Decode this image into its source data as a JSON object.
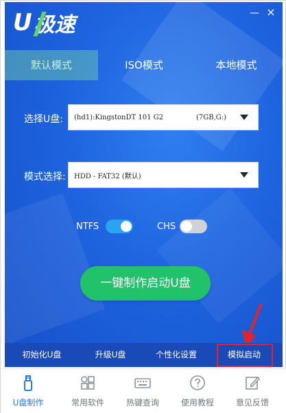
{
  "app": {
    "logo_u": "U",
    "logo_text": "极速",
    "minimize_glyph": "—",
    "close_glyph": "×"
  },
  "tabs": [
    {
      "label": "默认模式",
      "active": true
    },
    {
      "label": "ISO模式",
      "active": false
    },
    {
      "label": "本地模式",
      "active": false
    }
  ],
  "form": {
    "disk_label": "选择U盘:",
    "disk_name": "(hd1):KingstonDT 101 G2",
    "disk_size": "(7GB,G:)",
    "mode_label": "模式选择:",
    "mode_value": "HDD - FAT32 (默认)"
  },
  "toggles": {
    "ntfs_label": "NTFS",
    "ntfs_on": true,
    "chs_label": "CHS",
    "chs_on": false
  },
  "make_button": "一键制作启动U盘",
  "functions": [
    "初始化U盘",
    "升级U盘",
    "个性化设置",
    "模拟启动"
  ],
  "nav": [
    {
      "label": "U盘制作",
      "icon": "usb-icon",
      "active": true
    },
    {
      "label": "常用软件",
      "icon": "apps-grid-icon",
      "active": false
    },
    {
      "label": "热键查询",
      "icon": "keyboard-icon",
      "active": false
    },
    {
      "label": "使用教程",
      "icon": "help-icon",
      "active": false
    },
    {
      "label": "意见反馈",
      "icon": "edit-icon",
      "active": false
    }
  ],
  "colors": {
    "panel_blue": "#1e63df",
    "accent_green": "#22c26b",
    "toggle_on": "#2aa3f0",
    "highlight_red": "#e3232b",
    "nav_active": "#2b78e4"
  }
}
